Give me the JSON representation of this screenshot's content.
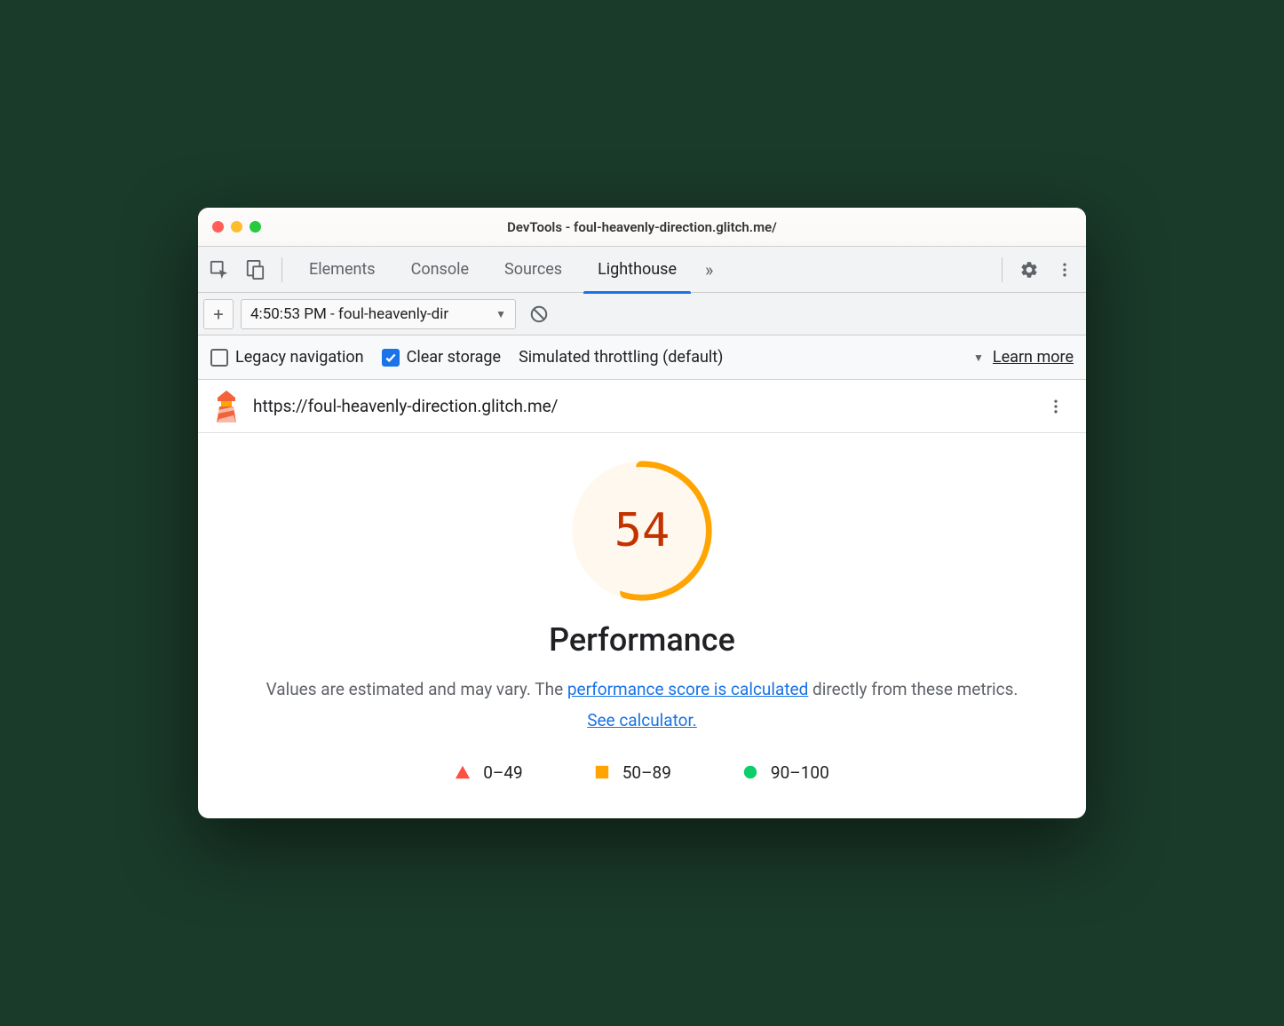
{
  "window": {
    "title": "DevTools - foul-heavenly-direction.glitch.me/"
  },
  "tabs": {
    "elements": "Elements",
    "console": "Console",
    "sources": "Sources",
    "lighthouse": "Lighthouse"
  },
  "toolbar": {
    "report_label": "4:50:53 PM - foul-heavenly-dir"
  },
  "options": {
    "legacy_nav": "Legacy navigation",
    "clear_storage": "Clear storage",
    "throttling": "Simulated throttling (default)",
    "learn_more": "Learn more"
  },
  "report": {
    "url": "https://foul-heavenly-direction.glitch.me/",
    "score": "54",
    "title": "Performance",
    "desc_prefix": "Values are estimated and may vary. The ",
    "desc_link1": "performance score is calculated",
    "desc_mid": " directly from these metrics. ",
    "desc_link2": "See calculator.",
    "legend": {
      "fail": "0–49",
      "avg": "50–89",
      "pass": "90–100"
    }
  },
  "colors": {
    "accent": "#1a73e8",
    "fail": "#ff4e42",
    "avg": "#ffa400",
    "pass": "#0cce6b"
  }
}
